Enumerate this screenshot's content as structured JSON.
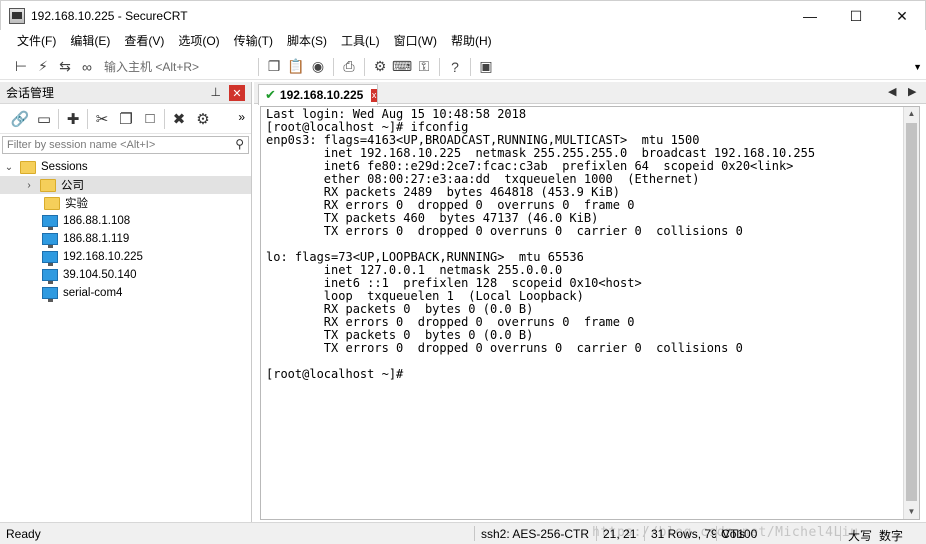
{
  "window": {
    "title": "192.168.10.225 - SecureCRT"
  },
  "menu": {
    "items": [
      "文件(F)",
      "编辑(E)",
      "查看(V)",
      "选项(O)",
      "传输(T)",
      "脚本(S)",
      "工具(L)",
      "窗口(W)",
      "帮助(H)"
    ]
  },
  "toolbar": {
    "quick_connect_placeholder": "输入主机 <Alt+R>"
  },
  "session_manager": {
    "title": "会话管理",
    "filter_placeholder": "Filter by session name <Alt+I>",
    "tree": {
      "root": "Sessions",
      "folders": [
        "公司",
        "实验"
      ],
      "sessions": [
        "186.88.1.108",
        "186.88.1.119",
        "192.168.10.225",
        "39.104.50.140",
        "serial-com4"
      ]
    }
  },
  "tab": {
    "label": "192.168.10.225",
    "close": "x"
  },
  "terminal": {
    "lines": [
      "Last login: Wed Aug 15 10:48:58 2018",
      "[root@localhost ~]# ifconfig",
      "enp0s3: flags=4163<UP,BROADCAST,RUNNING,MULTICAST>  mtu 1500",
      "        inet 192.168.10.225  netmask 255.255.255.0  broadcast 192.168.10.255",
      "        inet6 fe80::e29d:2ce7:fcac:c3ab  prefixlen 64  scopeid 0x20<link>",
      "        ether 08:00:27:e3:aa:dd  txqueuelen 1000  (Ethernet)",
      "        RX packets 2489  bytes 464818 (453.9 KiB)",
      "        RX errors 0  dropped 0  overruns 0  frame 0",
      "        TX packets 460  bytes 47137 (46.0 KiB)",
      "        TX errors 0  dropped 0 overruns 0  carrier 0  collisions 0",
      "",
      "lo: flags=73<UP,LOOPBACK,RUNNING>  mtu 65536",
      "        inet 127.0.0.1  netmask 255.0.0.0",
      "        inet6 ::1  prefixlen 128  scopeid 0x10<host>",
      "        loop  txqueuelen 1  (Local Loopback)",
      "        RX packets 0  bytes 0 (0.0 B)",
      "        RX errors 0  dropped 0  overruns 0  frame 0",
      "        TX packets 0  bytes 0 (0.0 B)",
      "        TX errors 0  dropped 0 overruns 0  carrier 0  collisions 0",
      "",
      "[root@localhost ~]#"
    ]
  },
  "status": {
    "ready": "Ready",
    "cipher": "ssh2: AES-256-CTR",
    "cursor": "21,  21",
    "size": "31 Rows, 79 Cols",
    "term": "VT100",
    "caps": "大写",
    "num": "数字",
    "watermark": "https://blog.csdn.net/Michel4Liu"
  },
  "colors": {
    "accent_close": "#d0332b",
    "check": "#1e9b2b",
    "folder": "#f5cf5a",
    "monitor": "#2f9ae0"
  },
  "icons": [
    "app-icon",
    "connect-icon",
    "lightning-icon",
    "reconnect-icon",
    "link-icon",
    "copy-icon",
    "paste-icon",
    "binoculars-icon",
    "print-icon",
    "gear-icon",
    "keyboard-icon",
    "key-icon",
    "help-icon",
    "image-icon",
    "pin-icon",
    "search-icon"
  ]
}
